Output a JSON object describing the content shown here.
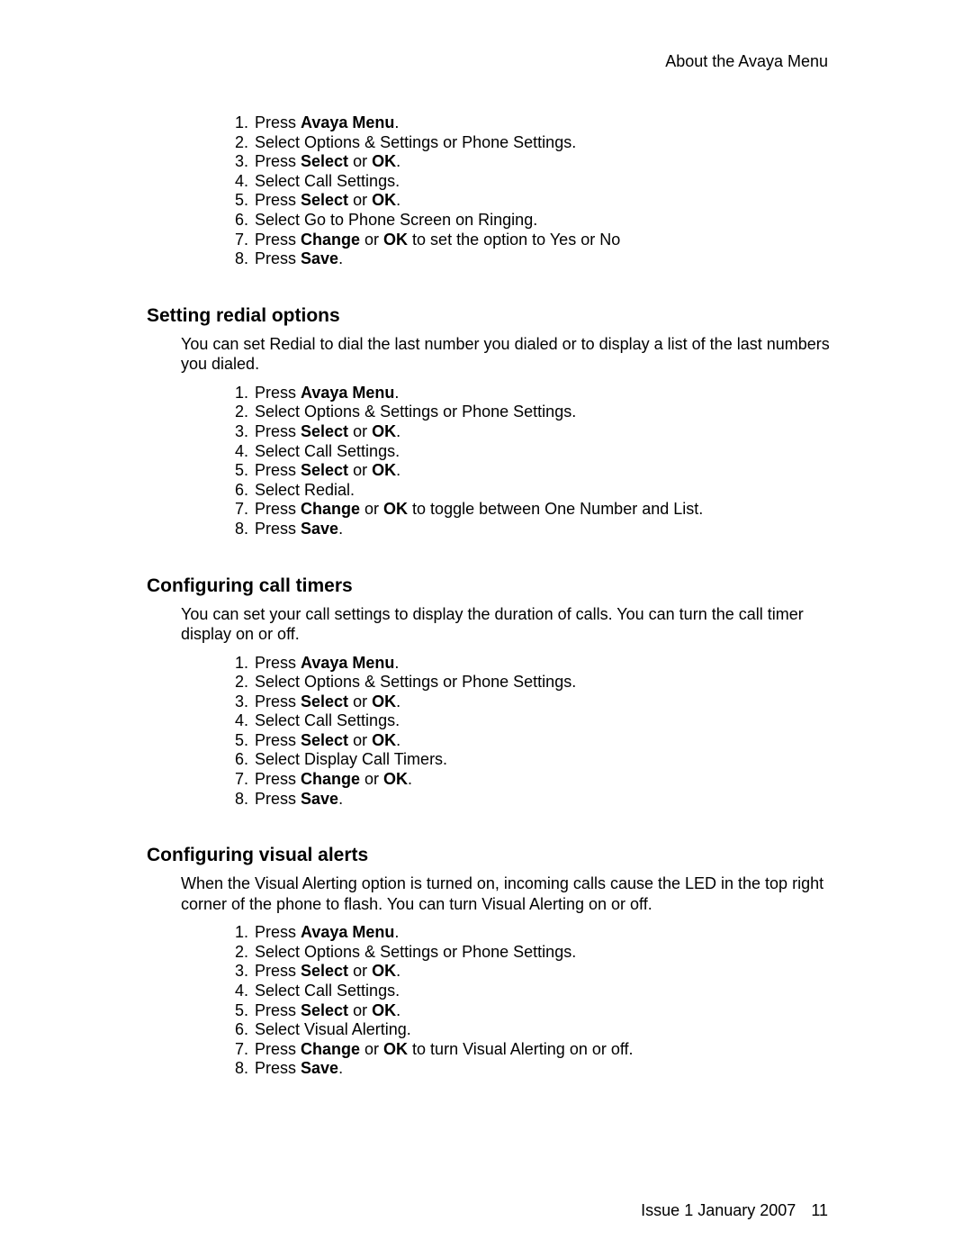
{
  "header": {
    "running_title": "About the Avaya Menu"
  },
  "sections": [
    {
      "heading": "",
      "intro": "",
      "steps": [
        [
          {
            "t": "Press "
          },
          {
            "t": "Avaya Menu",
            "b": true
          },
          {
            "t": "."
          }
        ],
        [
          {
            "t": "Select Options & Settings or Phone Settings."
          }
        ],
        [
          {
            "t": "Press "
          },
          {
            "t": "Select",
            "b": true
          },
          {
            "t": " or "
          },
          {
            "t": "OK",
            "b": true
          },
          {
            "t": "."
          }
        ],
        [
          {
            "t": "Select Call Settings."
          }
        ],
        [
          {
            "t": "Press "
          },
          {
            "t": "Select",
            "b": true
          },
          {
            "t": " or "
          },
          {
            "t": "OK",
            "b": true
          },
          {
            "t": "."
          }
        ],
        [
          {
            "t": "Select Go to Phone Screen on Ringing."
          }
        ],
        [
          {
            "t": "Press "
          },
          {
            "t": "Change",
            "b": true
          },
          {
            "t": " or "
          },
          {
            "t": "OK",
            "b": true
          },
          {
            "t": " to set the option to Yes or No"
          }
        ],
        [
          {
            "t": "Press "
          },
          {
            "t": "Save",
            "b": true
          },
          {
            "t": "."
          }
        ]
      ]
    },
    {
      "heading": "Setting redial options",
      "intro": "You can set Redial to dial the last number you dialed or to display a list of the last numbers you dialed.",
      "steps": [
        [
          {
            "t": "Press "
          },
          {
            "t": "Avaya Menu",
            "b": true
          },
          {
            "t": "."
          }
        ],
        [
          {
            "t": "Select Options & Settings or Phone Settings."
          }
        ],
        [
          {
            "t": "Press "
          },
          {
            "t": "Select",
            "b": true
          },
          {
            "t": " or "
          },
          {
            "t": "OK",
            "b": true
          },
          {
            "t": "."
          }
        ],
        [
          {
            "t": "Select Call Settings."
          }
        ],
        [
          {
            "t": "Press "
          },
          {
            "t": "Select",
            "b": true
          },
          {
            "t": " or "
          },
          {
            "t": "OK",
            "b": true
          },
          {
            "t": "."
          }
        ],
        [
          {
            "t": "Select Redial."
          }
        ],
        [
          {
            "t": "Press "
          },
          {
            "t": "Change",
            "b": true
          },
          {
            "t": " or "
          },
          {
            "t": "OK",
            "b": true
          },
          {
            "t": " to toggle between One Number and List."
          }
        ],
        [
          {
            "t": "Press "
          },
          {
            "t": "Save",
            "b": true
          },
          {
            "t": "."
          }
        ]
      ]
    },
    {
      "heading": "Configuring call timers",
      "intro": "You can set your call settings to display the duration of calls. You can turn the call timer display on or off.",
      "steps": [
        [
          {
            "t": "Press "
          },
          {
            "t": "Avaya Menu",
            "b": true
          },
          {
            "t": "."
          }
        ],
        [
          {
            "t": "Select Options & Settings or Phone Settings."
          }
        ],
        [
          {
            "t": "Press "
          },
          {
            "t": "Select",
            "b": true
          },
          {
            "t": " or "
          },
          {
            "t": "OK",
            "b": true
          },
          {
            "t": "."
          }
        ],
        [
          {
            "t": "Select Call Settings."
          }
        ],
        [
          {
            "t": "Press "
          },
          {
            "t": "Select",
            "b": true
          },
          {
            "t": " or "
          },
          {
            "t": "OK",
            "b": true
          },
          {
            "t": "."
          }
        ],
        [
          {
            "t": "Select Display Call Timers."
          }
        ],
        [
          {
            "t": "Press "
          },
          {
            "t": "Change",
            "b": true
          },
          {
            "t": " or "
          },
          {
            "t": "OK",
            "b": true
          },
          {
            "t": "."
          }
        ],
        [
          {
            "t": "Press "
          },
          {
            "t": "Save",
            "b": true
          },
          {
            "t": "."
          }
        ]
      ]
    },
    {
      "heading": "Configuring visual alerts",
      "intro": "When the Visual Alerting option is turned on, incoming calls cause the LED in the top right corner of the phone to flash. You can turn Visual Alerting on or off.",
      "steps": [
        [
          {
            "t": "Press "
          },
          {
            "t": "Avaya Menu",
            "b": true
          },
          {
            "t": "."
          }
        ],
        [
          {
            "t": "Select Options & Settings or Phone Settings."
          }
        ],
        [
          {
            "t": "Press "
          },
          {
            "t": "Select",
            "b": true
          },
          {
            "t": " or "
          },
          {
            "t": "OK",
            "b": true
          },
          {
            "t": "."
          }
        ],
        [
          {
            "t": "Select Call Settings."
          }
        ],
        [
          {
            "t": "Press "
          },
          {
            "t": "Select",
            "b": true
          },
          {
            "t": " or "
          },
          {
            "t": "OK",
            "b": true
          },
          {
            "t": "."
          }
        ],
        [
          {
            "t": "Select Visual Alerting."
          }
        ],
        [
          {
            "t": "Press "
          },
          {
            "t": "Change",
            "b": true
          },
          {
            "t": " or "
          },
          {
            "t": "OK",
            "b": true
          },
          {
            "t": " to turn Visual Alerting on or off."
          }
        ],
        [
          {
            "t": "Press "
          },
          {
            "t": "Save",
            "b": true
          },
          {
            "t": "."
          }
        ]
      ]
    }
  ],
  "footer": {
    "issue": "Issue 1 January 2007",
    "page_number": "11"
  }
}
